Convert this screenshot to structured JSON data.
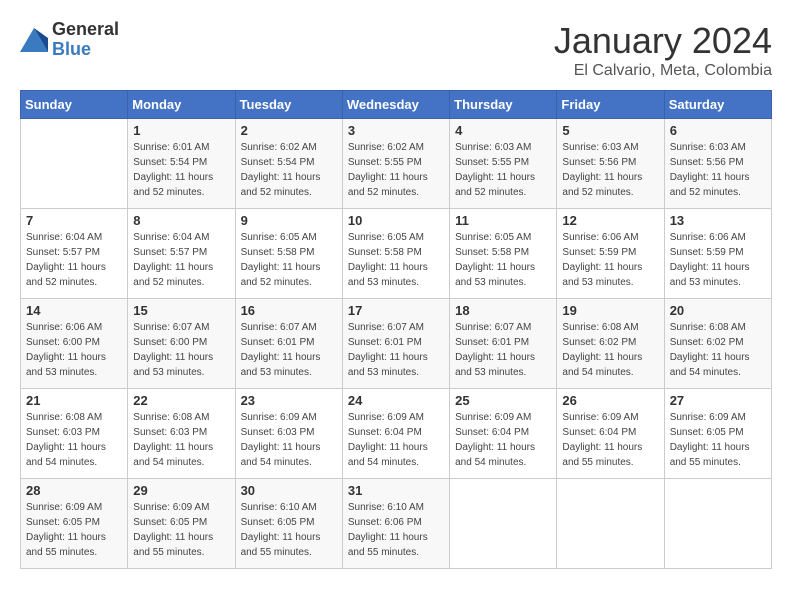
{
  "header": {
    "logo_general": "General",
    "logo_blue": "Blue",
    "month_title": "January 2024",
    "location": "El Calvario, Meta, Colombia"
  },
  "days_of_week": [
    "Sunday",
    "Monday",
    "Tuesday",
    "Wednesday",
    "Thursday",
    "Friday",
    "Saturday"
  ],
  "weeks": [
    [
      {
        "day": "",
        "info": ""
      },
      {
        "day": "1",
        "info": "Sunrise: 6:01 AM\nSunset: 5:54 PM\nDaylight: 11 hours\nand 52 minutes."
      },
      {
        "day": "2",
        "info": "Sunrise: 6:02 AM\nSunset: 5:54 PM\nDaylight: 11 hours\nand 52 minutes."
      },
      {
        "day": "3",
        "info": "Sunrise: 6:02 AM\nSunset: 5:55 PM\nDaylight: 11 hours\nand 52 minutes."
      },
      {
        "day": "4",
        "info": "Sunrise: 6:03 AM\nSunset: 5:55 PM\nDaylight: 11 hours\nand 52 minutes."
      },
      {
        "day": "5",
        "info": "Sunrise: 6:03 AM\nSunset: 5:56 PM\nDaylight: 11 hours\nand 52 minutes."
      },
      {
        "day": "6",
        "info": "Sunrise: 6:03 AM\nSunset: 5:56 PM\nDaylight: 11 hours\nand 52 minutes."
      }
    ],
    [
      {
        "day": "7",
        "info": "Sunrise: 6:04 AM\nSunset: 5:57 PM\nDaylight: 11 hours\nand 52 minutes."
      },
      {
        "day": "8",
        "info": "Sunrise: 6:04 AM\nSunset: 5:57 PM\nDaylight: 11 hours\nand 52 minutes."
      },
      {
        "day": "9",
        "info": "Sunrise: 6:05 AM\nSunset: 5:58 PM\nDaylight: 11 hours\nand 52 minutes."
      },
      {
        "day": "10",
        "info": "Sunrise: 6:05 AM\nSunset: 5:58 PM\nDaylight: 11 hours\nand 53 minutes."
      },
      {
        "day": "11",
        "info": "Sunrise: 6:05 AM\nSunset: 5:58 PM\nDaylight: 11 hours\nand 53 minutes."
      },
      {
        "day": "12",
        "info": "Sunrise: 6:06 AM\nSunset: 5:59 PM\nDaylight: 11 hours\nand 53 minutes."
      },
      {
        "day": "13",
        "info": "Sunrise: 6:06 AM\nSunset: 5:59 PM\nDaylight: 11 hours\nand 53 minutes."
      }
    ],
    [
      {
        "day": "14",
        "info": "Sunrise: 6:06 AM\nSunset: 6:00 PM\nDaylight: 11 hours\nand 53 minutes."
      },
      {
        "day": "15",
        "info": "Sunrise: 6:07 AM\nSunset: 6:00 PM\nDaylight: 11 hours\nand 53 minutes."
      },
      {
        "day": "16",
        "info": "Sunrise: 6:07 AM\nSunset: 6:01 PM\nDaylight: 11 hours\nand 53 minutes."
      },
      {
        "day": "17",
        "info": "Sunrise: 6:07 AM\nSunset: 6:01 PM\nDaylight: 11 hours\nand 53 minutes."
      },
      {
        "day": "18",
        "info": "Sunrise: 6:07 AM\nSunset: 6:01 PM\nDaylight: 11 hours\nand 53 minutes."
      },
      {
        "day": "19",
        "info": "Sunrise: 6:08 AM\nSunset: 6:02 PM\nDaylight: 11 hours\nand 54 minutes."
      },
      {
        "day": "20",
        "info": "Sunrise: 6:08 AM\nSunset: 6:02 PM\nDaylight: 11 hours\nand 54 minutes."
      }
    ],
    [
      {
        "day": "21",
        "info": "Sunrise: 6:08 AM\nSunset: 6:03 PM\nDaylight: 11 hours\nand 54 minutes."
      },
      {
        "day": "22",
        "info": "Sunrise: 6:08 AM\nSunset: 6:03 PM\nDaylight: 11 hours\nand 54 minutes."
      },
      {
        "day": "23",
        "info": "Sunrise: 6:09 AM\nSunset: 6:03 PM\nDaylight: 11 hours\nand 54 minutes."
      },
      {
        "day": "24",
        "info": "Sunrise: 6:09 AM\nSunset: 6:04 PM\nDaylight: 11 hours\nand 54 minutes."
      },
      {
        "day": "25",
        "info": "Sunrise: 6:09 AM\nSunset: 6:04 PM\nDaylight: 11 hours\nand 54 minutes."
      },
      {
        "day": "26",
        "info": "Sunrise: 6:09 AM\nSunset: 6:04 PM\nDaylight: 11 hours\nand 55 minutes."
      },
      {
        "day": "27",
        "info": "Sunrise: 6:09 AM\nSunset: 6:05 PM\nDaylight: 11 hours\nand 55 minutes."
      }
    ],
    [
      {
        "day": "28",
        "info": "Sunrise: 6:09 AM\nSunset: 6:05 PM\nDaylight: 11 hours\nand 55 minutes."
      },
      {
        "day": "29",
        "info": "Sunrise: 6:09 AM\nSunset: 6:05 PM\nDaylight: 11 hours\nand 55 minutes."
      },
      {
        "day": "30",
        "info": "Sunrise: 6:10 AM\nSunset: 6:05 PM\nDaylight: 11 hours\nand 55 minutes."
      },
      {
        "day": "31",
        "info": "Sunrise: 6:10 AM\nSunset: 6:06 PM\nDaylight: 11 hours\nand 55 minutes."
      },
      {
        "day": "",
        "info": ""
      },
      {
        "day": "",
        "info": ""
      },
      {
        "day": "",
        "info": ""
      }
    ]
  ]
}
